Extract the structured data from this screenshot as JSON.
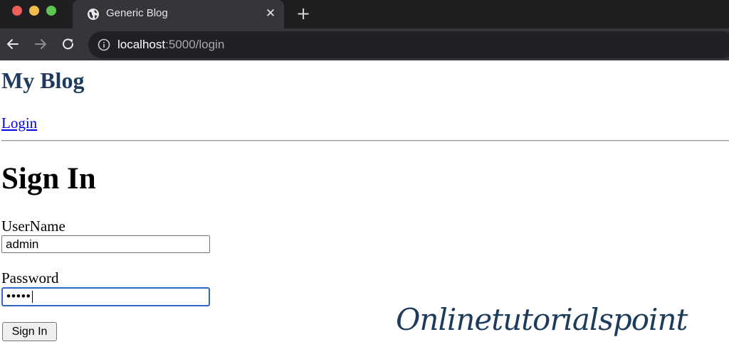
{
  "browser": {
    "tab_title": "Generic Blog",
    "close_glyph": "✕",
    "new_tab_glyph": "+",
    "url_host": "localhost",
    "url_path": ":5000/login",
    "icons": {
      "tab": "globe-icon",
      "back": "arrow-left-icon",
      "forward": "arrow-right-icon",
      "reload": "reload-icon",
      "info": "info-icon"
    },
    "colors": {
      "titlebar": "#1f1f21",
      "toolbar": "#35363a",
      "omnibox": "#202124"
    }
  },
  "site": {
    "title": "My Blog",
    "nav_login": "Login"
  },
  "form": {
    "heading": "Sign In",
    "username_label": "UserName",
    "username_value": "admin",
    "password_label": "Password",
    "password_mask": "•••••",
    "submit_label": "Sign In"
  },
  "watermark": "Onlinetutorialspoint",
  "colors": {
    "site_title": "#1e3a5f",
    "link": "#0000ee",
    "focus_ring": "#3067c4",
    "watermark": "#1d3c5c"
  }
}
